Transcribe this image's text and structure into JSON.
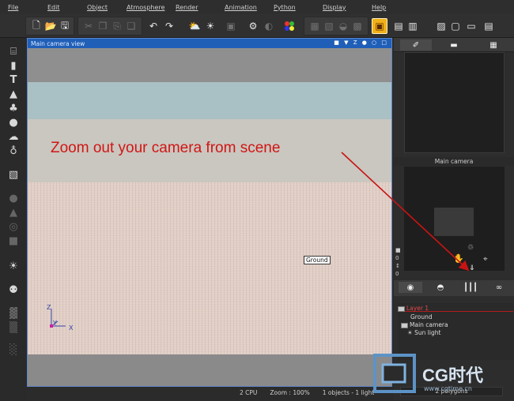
{
  "menubar": {
    "items": [
      "File",
      "Edit",
      "Object",
      "Atmosphere",
      "Render",
      "Animation",
      "Python",
      "Display",
      "Help"
    ]
  },
  "viewport": {
    "title": "Main camera view",
    "controls": "■ ▼ Z ● ○ □",
    "object_label": "Ground",
    "axes": {
      "z": "Z",
      "y": "Y",
      "x": "X"
    }
  },
  "annotation": {
    "text": "Zoom out your camera from scene",
    "color": "#d11515"
  },
  "right_panel": {
    "camera_header": "Main camera",
    "tree": {
      "layer": "Layer 1",
      "items": [
        "Ground",
        "Main camera",
        "Sun light"
      ]
    },
    "polygons": "2 polygons"
  },
  "status": {
    "cpu": "2 CPU",
    "zoom": "Zoom : 100%",
    "objects": "1 objects - 1 light"
  },
  "watermark": {
    "brand": "CG时代",
    "url": "www.cgtime.cn"
  },
  "colors": {
    "accent": "#1f5fb8",
    "selected_tool": "#f2b018",
    "arrow": "#c81414"
  }
}
